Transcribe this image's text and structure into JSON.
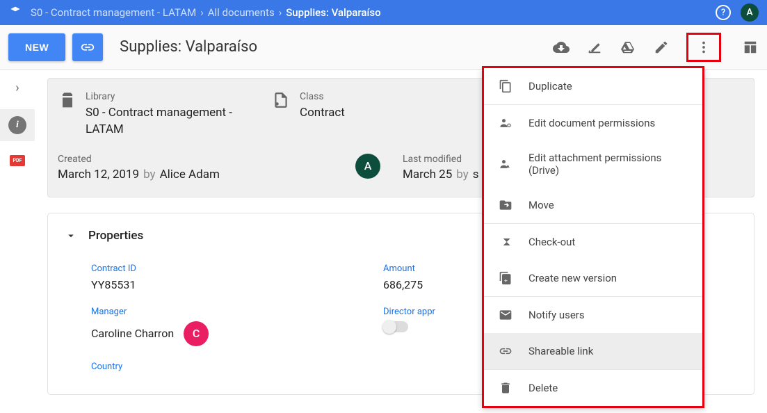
{
  "breadcrumb": {
    "items": [
      "S0 - Contract management - LATAM",
      "All documents",
      "Supplies: Valparaíso"
    ]
  },
  "user_initial": "A",
  "toolbar": {
    "new_label": "NEW",
    "title": "Supplies: Valparaíso"
  },
  "meta": {
    "library_label": "Library",
    "library_value": "S0 - Contract management - LATAM",
    "class_label": "Class",
    "class_value": "Contract",
    "created_label": "Created",
    "created_date": "March 12, 2019",
    "created_by_word": "by",
    "created_by": "Alice Adam",
    "created_initial": "A",
    "modified_label": "Last modified",
    "modified_date": "March 25",
    "modified_by_word": "by",
    "modified_by": "s"
  },
  "properties": {
    "header": "Properties",
    "contract_id_label": "Contract ID",
    "contract_id_value": "YY85531",
    "amount_label": "Amount",
    "amount_value": "686,275",
    "manager_label": "Manager",
    "manager_value": "Caroline Charron",
    "manager_initial": "C",
    "director_approval_label": "Director appr",
    "country_label": "Country"
  },
  "menu": {
    "duplicate": "Duplicate",
    "edit_doc_perms": "Edit document permissions",
    "edit_att_perms": "Edit attachment permissions (Drive)",
    "move": "Move",
    "checkout": "Check-out",
    "create_version": "Create new version",
    "notify": "Notify users",
    "shareable": "Shareable link",
    "delete": "Delete"
  }
}
